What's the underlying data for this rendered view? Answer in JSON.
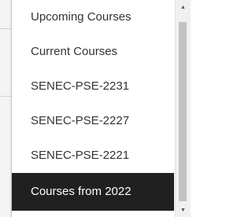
{
  "dropdown": {
    "options": [
      {
        "label": "Upcoming Courses"
      },
      {
        "label": "Current Courses"
      },
      {
        "label": "SENEC-PSE-2231"
      },
      {
        "label": "SENEC-PSE-2227"
      },
      {
        "label": "SENEC-PSE-2221"
      },
      {
        "label": "Courses from 2022"
      }
    ],
    "selected_label": "Courses from 2022"
  },
  "scrollbar": {
    "up_icon": "triangle-up-icon",
    "down_icon": "triangle-down-icon",
    "thumb_position_fraction": 0.05
  },
  "colors": {
    "selected_background": "#202020",
    "selected_text": "#ffffff",
    "item_text": "#333333"
  }
}
